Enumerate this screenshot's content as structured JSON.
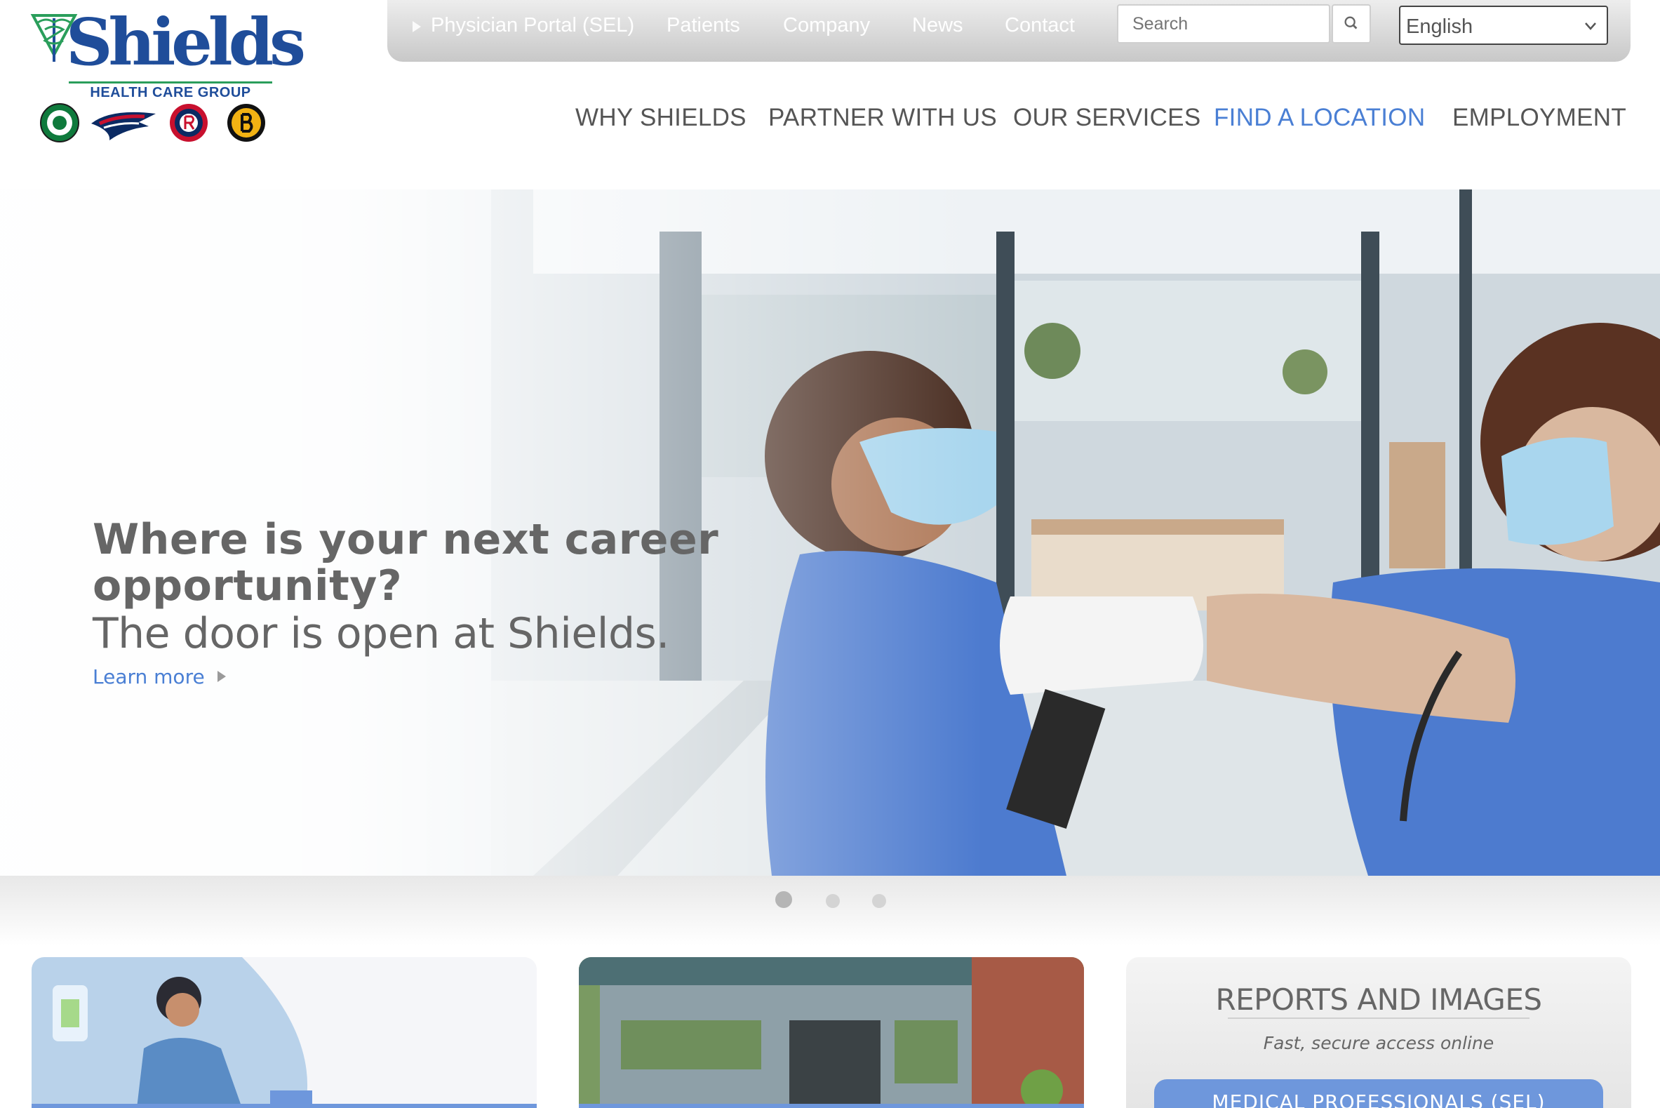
{
  "brand": {
    "name": "Shields",
    "tagline": "HEALTH CARE GROUP",
    "colors": {
      "primary": "#1f4d9a",
      "accent": "#4a7fd4",
      "green": "#2a9e5b"
    },
    "team_logos": [
      "celtics-logo",
      "patriots-logo",
      "revolution-logo",
      "bruins-logo"
    ]
  },
  "utility_nav": {
    "items": [
      {
        "label": "Physician Portal (SEL)"
      },
      {
        "label": "Patients"
      },
      {
        "label": "Company"
      },
      {
        "label": "News"
      },
      {
        "label": "Contact"
      }
    ],
    "search": {
      "placeholder": "Search",
      "icon": "search-icon"
    },
    "language": {
      "selected": "English"
    }
  },
  "main_nav": {
    "items": [
      {
        "label": "WHY SHIELDS"
      },
      {
        "label": "PARTNER WITH US"
      },
      {
        "label": "OUR SERVICES"
      },
      {
        "label": "FIND A LOCATION",
        "active": true
      },
      {
        "label": "EMPLOYMENT"
      }
    ]
  },
  "hero": {
    "title": "Where is your next career opportunity?",
    "subtitle": "The door is open at Shields.",
    "link": "Learn more"
  },
  "carousel": {
    "slides": 3,
    "active": 1
  },
  "cards": {
    "reports": {
      "title": "REPORTS AND IMAGES",
      "subtitle": "Fast, secure access online",
      "button": "MEDICAL PROFESSIONALS (SEL)"
    }
  }
}
